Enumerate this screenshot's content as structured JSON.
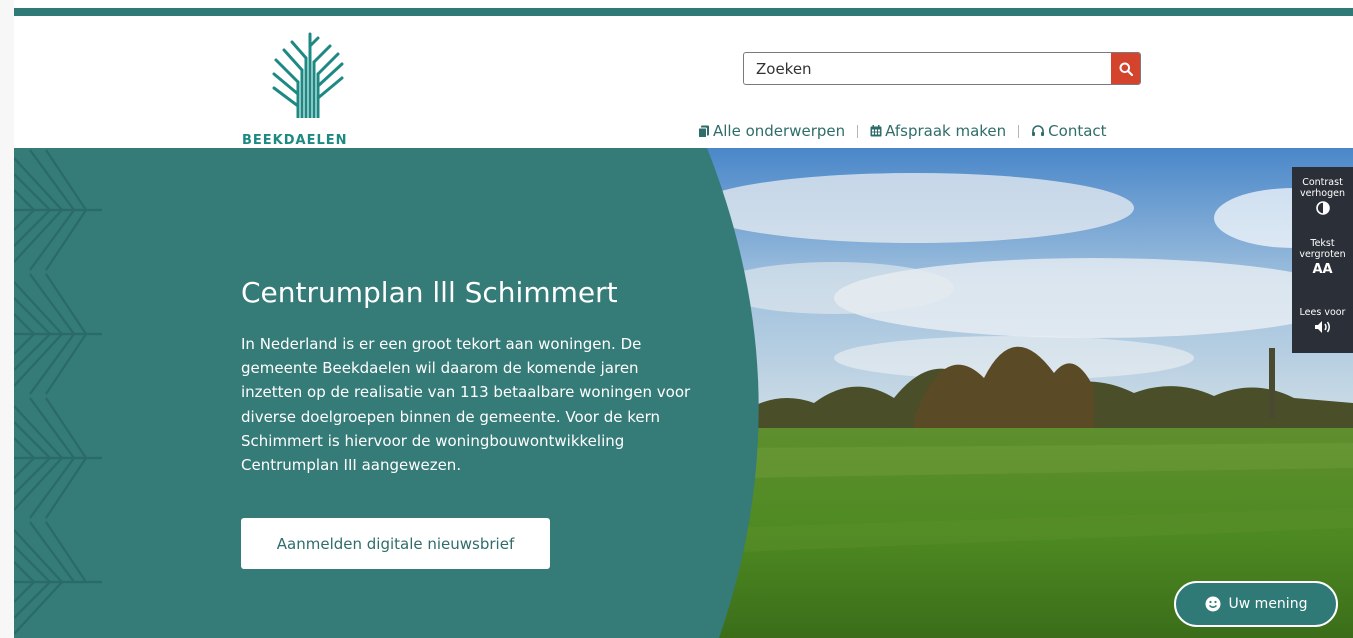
{
  "logo": {
    "text": "BEEKDAELEN"
  },
  "search": {
    "placeholder": "Zoeken",
    "icon": "search-icon"
  },
  "nav": {
    "items": [
      {
        "label": "Alle onderwerpen",
        "icon": "documents-icon"
      },
      {
        "label": "Afspraak maken",
        "icon": "calendar-icon"
      },
      {
        "label": "Contact",
        "icon": "headset-icon"
      }
    ]
  },
  "hero": {
    "title": "Centrumplan lll Schimmert",
    "text": "In Nederland is er een groot tekort aan woningen. De gemeente Beekdaelen wil daarom de komende jaren inzetten op de realisatie van 113 betaalbare woningen voor diverse doelgroepen binnen de gemeente. Voor de kern Schimmert is hiervoor de woningbouwontwikkeling Centrumplan III aangewezen.",
    "button_label": "Aanmelden digitale nieuwsbrief"
  },
  "accessibility": {
    "contrast_line1": "Contrast",
    "contrast_line2": "verhogen",
    "text_line1": "Tekst",
    "text_line2": "vergroten",
    "text_icon": "AA",
    "read_label": "Lees voor"
  },
  "feedback": {
    "label": "Uw mening",
    "icon": "smiley-icon"
  },
  "colors": {
    "brand_teal": "#2f7a77",
    "logo_teal": "#1c8a83",
    "search_button": "#d4432b",
    "panel_dark": "#2b2f37"
  }
}
